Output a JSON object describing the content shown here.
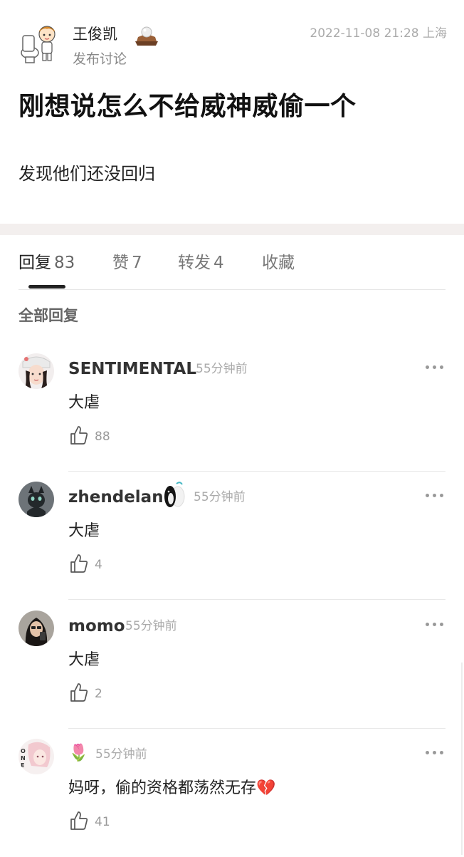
{
  "post": {
    "author_name": "王俊凯",
    "author_badge_icon": "pearl-on-stand-icon",
    "meta_text": "发布讨论",
    "timestamp": "2022-11-08 21:28",
    "location": "上海",
    "title": "刚想说怎么不给威神威偷一个",
    "body": "发现他们还没回归"
  },
  "tabs": [
    {
      "label": "回复",
      "count": "83",
      "active": true
    },
    {
      "label": "赞",
      "count": "7",
      "active": false
    },
    {
      "label": "转发",
      "count": "4",
      "active": false
    },
    {
      "label": "收藏",
      "count": "",
      "active": false
    }
  ],
  "section_title": "全部回复",
  "comments": [
    {
      "username": "SENTIMENTAL",
      "time": "55分钟前",
      "text": "大虐",
      "likes": "88",
      "avatar_icon": "girl-avatar-icon"
    },
    {
      "username": "zhendelan",
      "time": "55分钟前",
      "text": "大虐",
      "likes": "4",
      "avatar_icon": "cat-avatar-icon",
      "badge_icon": "penguin-badge-icon"
    },
    {
      "username": "momo",
      "time": "55分钟前",
      "text": "大虐",
      "likes": "2",
      "avatar_icon": "woman-avatar-icon"
    },
    {
      "username": "🌷",
      "time": "55分钟前",
      "text": "妈呀，偷的资格都荡然无存💔",
      "likes": "41",
      "avatar_icon": "anime-avatar-icon"
    }
  ],
  "colors": {
    "text_primary": "#222222",
    "text_secondary": "#888888",
    "section_gap": "#f3efee",
    "divider": "#e8e8e8"
  }
}
